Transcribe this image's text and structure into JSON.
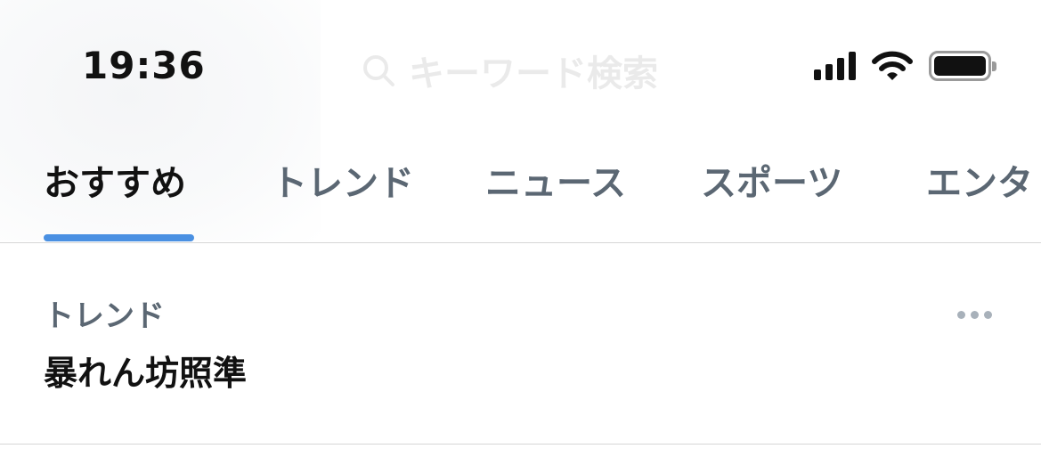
{
  "status_bar": {
    "time": "19:36"
  },
  "search": {
    "placeholder": "キーワード検索"
  },
  "tabs": [
    {
      "label": "おすすめ",
      "active": true
    },
    {
      "label": "トレンド",
      "active": false
    },
    {
      "label": "ニュース",
      "active": false
    },
    {
      "label": "スポーツ",
      "active": false
    },
    {
      "label": "エンタ",
      "active": false
    }
  ],
  "trend_item": {
    "category": "トレンド",
    "title": "暴れん坊照準"
  },
  "colors": {
    "accent": "#4a90e2",
    "text_primary": "#111111",
    "text_secondary": "#5b6773",
    "divider": "#d6d6d6"
  }
}
